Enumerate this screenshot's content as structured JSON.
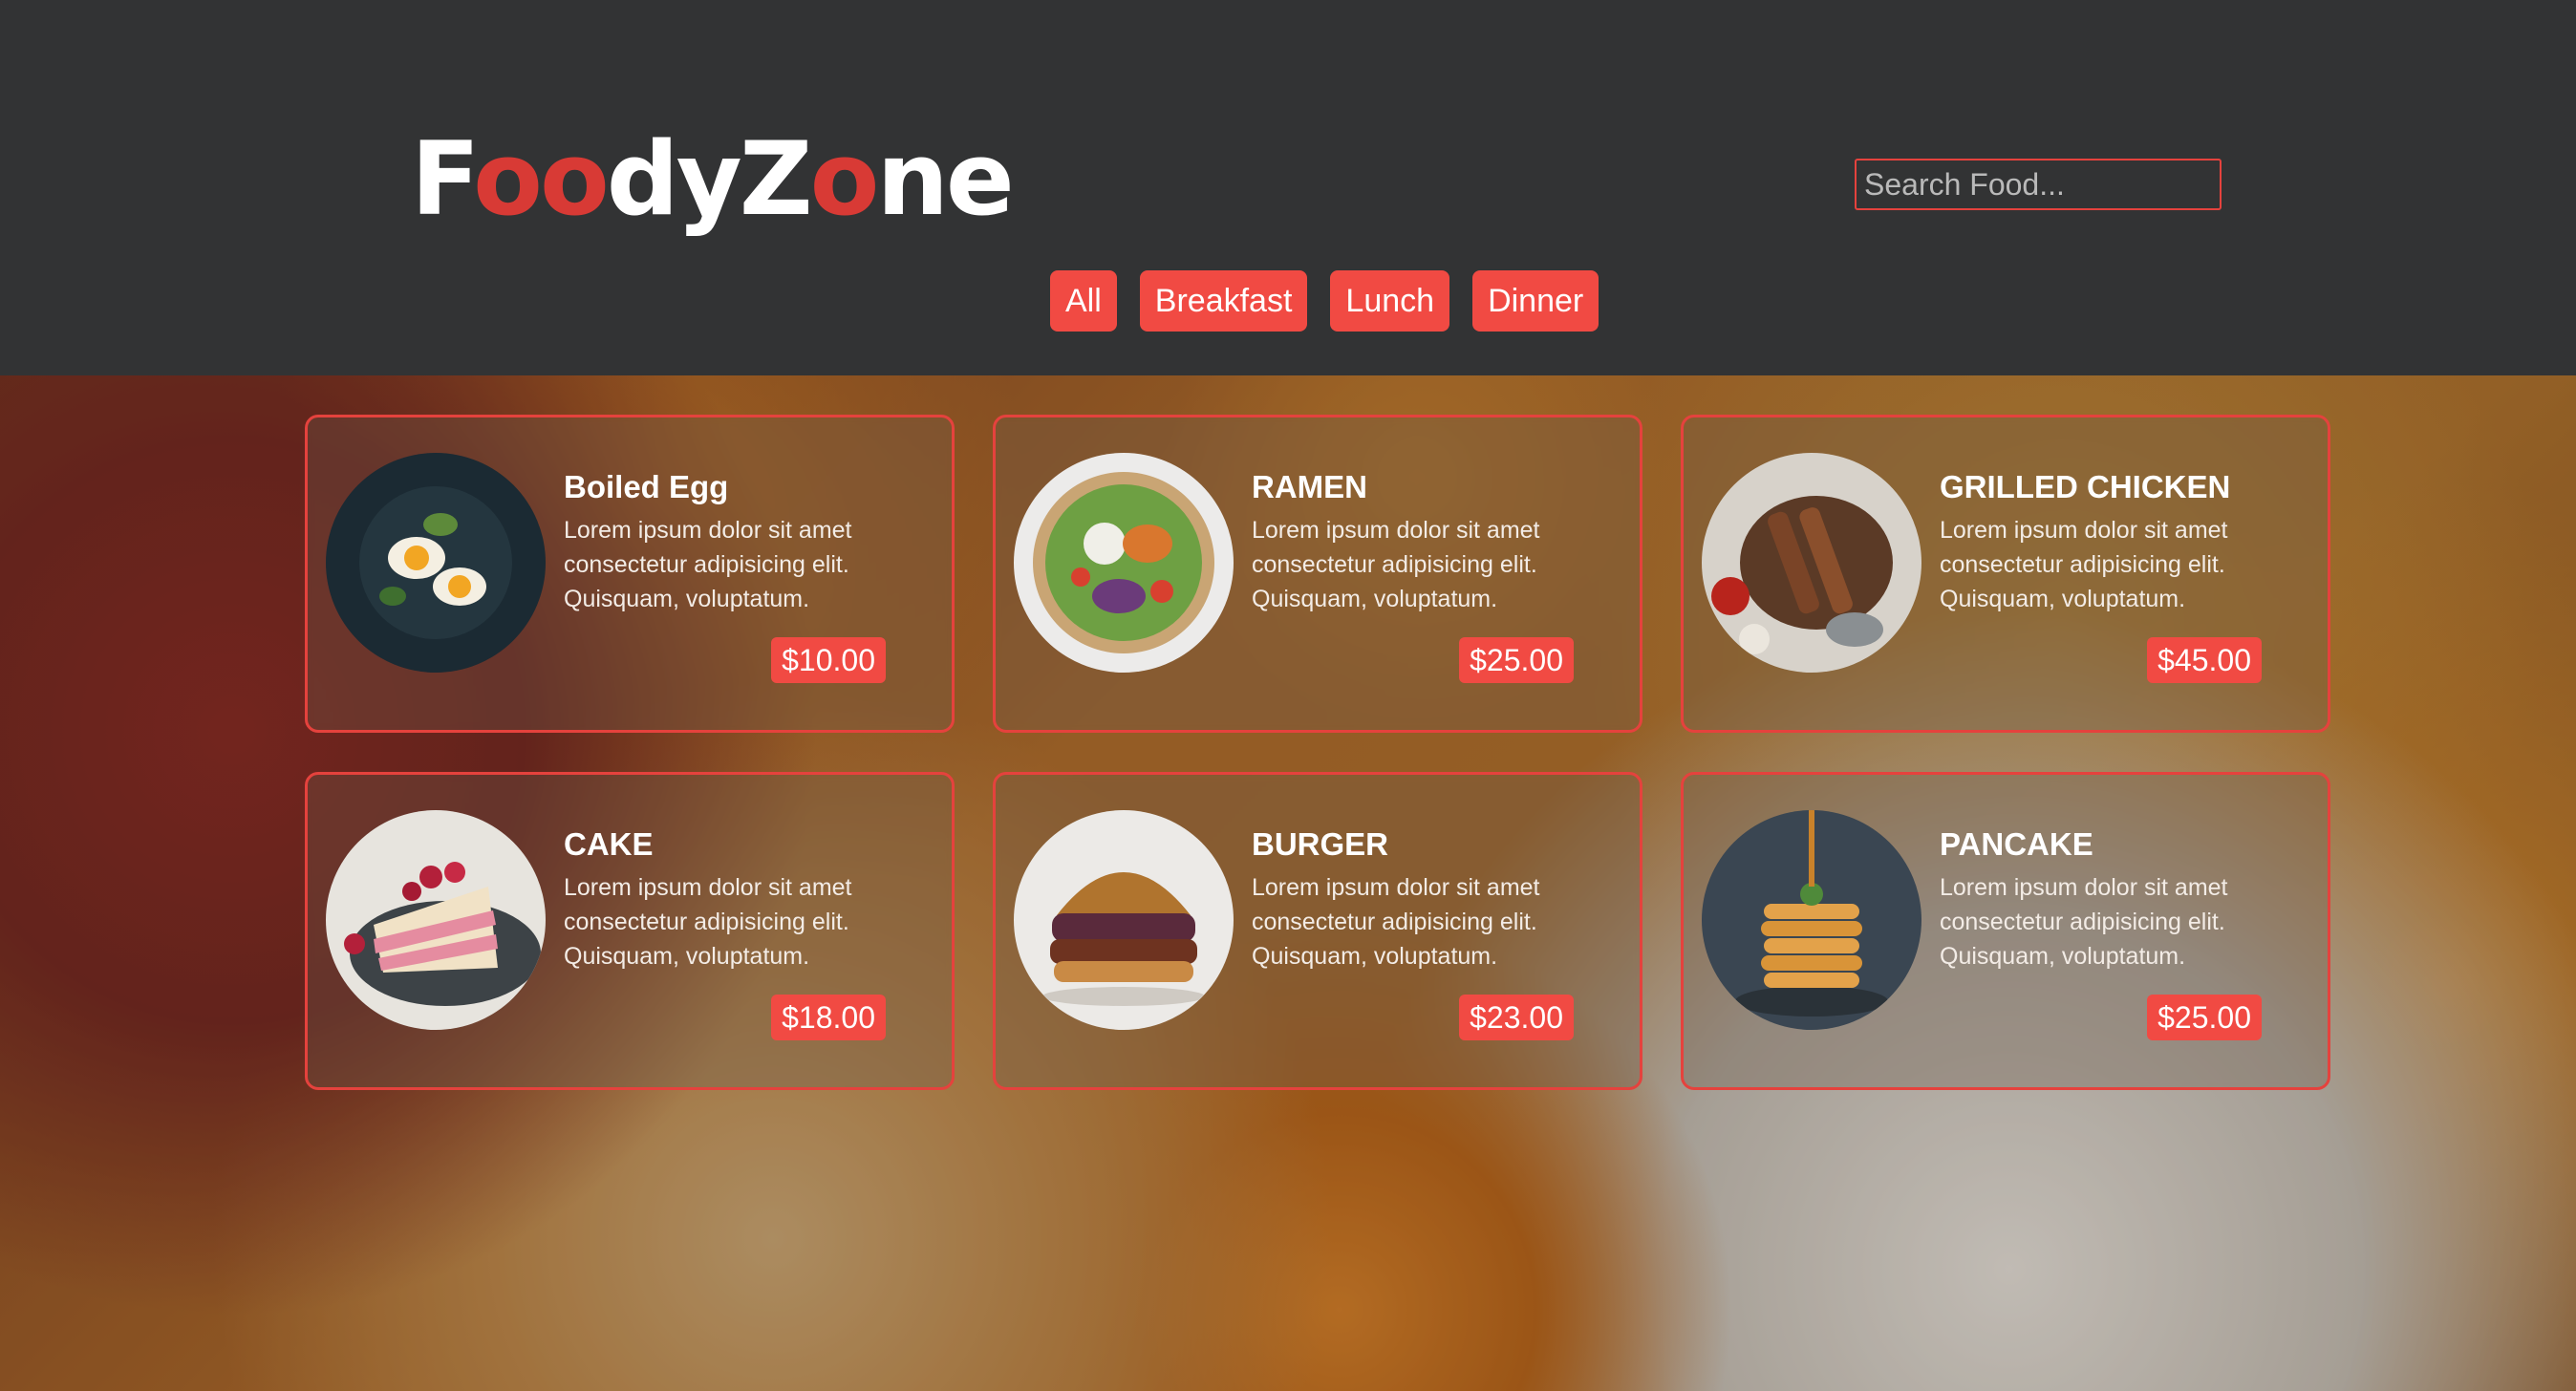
{
  "header": {
    "logo": {
      "part1": "F",
      "part2": "oo",
      "part3": "dyZ",
      "part4": "o",
      "part5": "ne"
    },
    "search_placeholder": "Search Food...",
    "filters": [
      "All",
      "Breakfast",
      "Lunch",
      "Dinner"
    ]
  },
  "colors": {
    "accent": "#f14a43",
    "header_bg": "#323334",
    "logo_red": "#d83a35"
  },
  "foods": [
    {
      "name": "Boiled Egg",
      "text": "Lorem ipsum dolor sit amet consectetur adipisicing elit. Quisquam, voluptatum.",
      "price": "$10.00",
      "image": "boiled-egg-image"
    },
    {
      "name": "RAMEN",
      "text": "Lorem ipsum dolor sit amet consectetur adipisicing elit. Quisquam, voluptatum.",
      "price": "$25.00",
      "image": "ramen-bowl-image"
    },
    {
      "name": "GRILLED CHICKEN",
      "text": "Lorem ipsum dolor sit amet consectetur adipisicing elit. Quisquam, voluptatum.",
      "price": "$45.00",
      "image": "grilled-chicken-image"
    },
    {
      "name": "CAKE",
      "text": "Lorem ipsum dolor sit amet consectetur adipisicing elit. Quisquam, voluptatum.",
      "price": "$18.00",
      "image": "cake-image"
    },
    {
      "name": "BURGER",
      "text": "Lorem ipsum dolor sit amet consectetur adipisicing elit. Quisquam, voluptatum.",
      "price": "$23.00",
      "image": "burger-image"
    },
    {
      "name": "PANCAKE",
      "text": "Lorem ipsum dolor sit amet consectetur adipisicing elit. Quisquam, voluptatum.",
      "price": "$25.00",
      "image": "pancake-image"
    }
  ]
}
